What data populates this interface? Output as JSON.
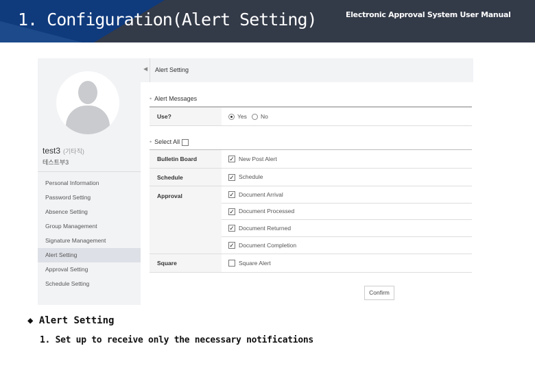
{
  "header": {
    "title": "1. Configuration(Alert Setting)",
    "manual": "Electronic Approval System User Manual"
  },
  "sidebar": {
    "user_name": "test3",
    "user_title": "(기타직)",
    "department": "테스트부3",
    "items": [
      {
        "label": "Personal Information"
      },
      {
        "label": "Password Setting"
      },
      {
        "label": "Absence Setting"
      },
      {
        "label": "Group Management"
      },
      {
        "label": "Signature Management"
      },
      {
        "label": "Alert Setting",
        "selected": true
      },
      {
        "label": "Approval Setting"
      },
      {
        "label": "Schedule Setting"
      }
    ]
  },
  "main": {
    "page_title": "Alert Setting",
    "alert_messages": {
      "heading": "Alert Messages",
      "use_label": "Use?",
      "yes": "Yes",
      "no": "No",
      "selected": "Yes"
    },
    "select_all": {
      "label": "Select All",
      "checked": false
    },
    "rows": [
      {
        "label": "Bulletin Board",
        "options": [
          {
            "label": "New Post Alert",
            "checked": true
          }
        ]
      },
      {
        "label": "Schedule",
        "options": [
          {
            "label": "Schedule",
            "checked": true
          }
        ]
      },
      {
        "label": "Approval",
        "options": [
          {
            "label": "Document Arrival",
            "checked": true
          },
          {
            "label": "Document Processed",
            "checked": true
          },
          {
            "label": "Document Returned",
            "checked": true
          },
          {
            "label": "Document Completion",
            "checked": true
          }
        ]
      },
      {
        "label": "Square",
        "options": [
          {
            "label": "Square Alert",
            "checked": false
          }
        ]
      }
    ],
    "confirm_label": "Confirm"
  },
  "notes": {
    "bullet": "◆",
    "heading": "Alert Setting",
    "item": "1. Set up to receive only the necessary notifications"
  },
  "colors": {
    "header_bg": "#333a48",
    "header_accent": "#0f3a7c",
    "sidebar_bg": "#f2f3f5",
    "selected_bg": "#dde0e6"
  }
}
